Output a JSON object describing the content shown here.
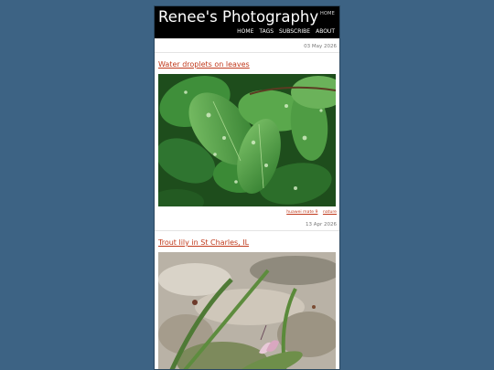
{
  "site": {
    "title": "Renee's Photography",
    "header_home": "HOME"
  },
  "nav": [
    {
      "label": "HOME"
    },
    {
      "label": "TAGS"
    },
    {
      "label": "SUBSCRIBE"
    },
    {
      "label": "ABOUT"
    }
  ],
  "posts": [
    {
      "date": "03 May 2026",
      "title": "Water droplets on leaves",
      "tags": [
        "huawei mate 9",
        "nature"
      ]
    },
    {
      "date": "13 Apr 2026",
      "title": "Trout lily in St Charles, IL"
    }
  ],
  "colors": {
    "background": "#3d6384",
    "link": "#c0391b",
    "header": "#000000"
  }
}
